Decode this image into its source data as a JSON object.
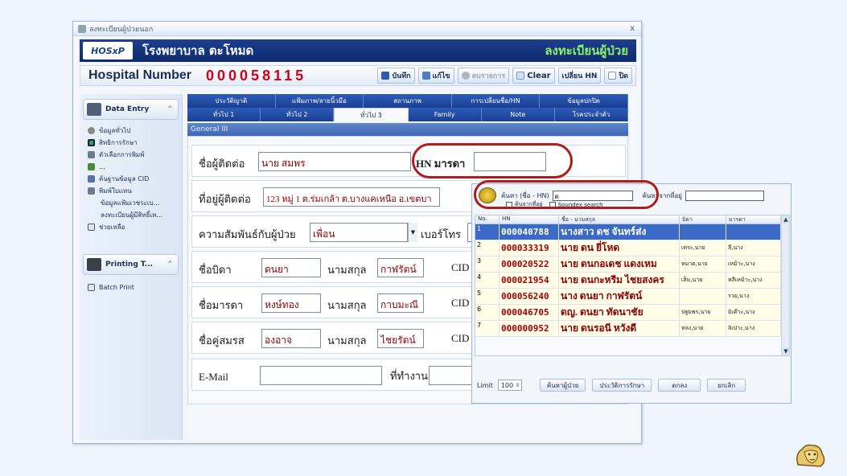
{
  "window": {
    "title": "ลงทะเบียนผู้ป่วยนอก",
    "close": "x"
  },
  "banner": {
    "logo_text": "HOSxP",
    "hospital": "โรงพยาบาล ตะโหมด",
    "page": "ลงทะเบียนผู้ป่วย"
  },
  "hnbar": {
    "label": "Hospital Number",
    "value": "000058115"
  },
  "toolbar": {
    "save": "บันทึก",
    "edit": "แก้ไข",
    "delete": "ลบรายการ",
    "clear": "Clear",
    "change_hn": "เปลี่ยน HN",
    "close": "ปิด"
  },
  "sidebar": {
    "data_entry_title": "Data Entry",
    "items": [
      {
        "label": "ข้อมูลทั่วไป",
        "icon": "user-icon"
      },
      {
        "label": "สิทธิการรักษา",
        "icon": "rights-icon"
      },
      {
        "label": "ตัวเลือกการพิมพ์",
        "icon": "print-option-icon"
      },
      {
        "label": "...",
        "icon": "more-icon"
      },
      {
        "label": "ค้นฐานข้อมูล CID",
        "icon": "cid-search-icon"
      },
      {
        "label": "พิมพ์ใบแทน",
        "icon": "print-icon"
      },
      {
        "label": "ข้อมูลแฟ้มเวชระเบ...",
        "icon": ""
      },
      {
        "label": "ลงทะเบียนผู้มีสิทธิ์เห...",
        "icon": ""
      },
      {
        "label": "ช่วยเหลือ",
        "icon": "help-icon"
      }
    ],
    "printing_title": "Printing T...",
    "batch_print": "Batch Print"
  },
  "tabs": {
    "row1": [
      "ประวัติญาติ",
      "แฟ้มภาพ/ลายนิ้วมือ",
      "สถานภาพ",
      "การเปลี่ยนชื่อ/HN",
      "ข้อมูลปกปิด"
    ],
    "row2": [
      "ทั่วไป 1",
      "ทั่วไป 2",
      "ทั่วไป 3",
      "Family",
      "Note",
      "โรคประจำตัว"
    ]
  },
  "group_title": "General III",
  "form": {
    "contact_label": "ชื่อผู้ติดต่อ",
    "contact_value": "นาย สมพร",
    "hn_mother_label": "HN มารดา",
    "hn_mother_value": "",
    "address_label": "ที่อยู่ผู้ติดต่อ",
    "address_value": "123 หมู่ 1 ต.ร่มเกล้า ต.บางแคเหนือ อ.เขตบา",
    "relation_label": "ความสัมพันธ์กับผู้ป่วย",
    "relation_value": "เพื่อน",
    "phone_label": "เบอร์โทร",
    "father_label": "ชื่อบิดา",
    "father_value": "ดนยา",
    "surname_label": "นามสกุล",
    "father_surname": "กาฬรัตน์",
    "cid_label": "CID",
    "mother_label": "ชื่อมารดา",
    "mother_value": "หงษ์ทอง",
    "mother_surname": "กาบมะณี",
    "spouse_label": "ชื่อคู่สมรส",
    "spouse_value": "องอาจ",
    "spouse_surname": "ไชยรัตน์",
    "email_label": "E-Mail",
    "workplace_label": "ที่ทำงาน"
  },
  "popup": {
    "search_label": "ค้นหา (ชื่อ - HN)",
    "search_value": "ด",
    "addr_search_label": "ค้นหาจากที่อยู่",
    "chk1": "ค้นจากที่อยู่",
    "chk2": "Soundex search",
    "columns": [
      "No.",
      "HN",
      "ชื่อ - นามสกุล",
      "บิดา",
      "มารดา"
    ],
    "rows": [
      {
        "no": "1",
        "hn": "000040788",
        "name": "นางสาว ดช  จันทร์ส่ง",
        "father": "",
        "mother": ""
      },
      {
        "no": "2",
        "hn": "000033319",
        "name": "นาย ดน  ยี่โหด",
        "father": "เทระ,นาย",
        "mother": "ลี,นาง"
      },
      {
        "no": "3",
        "hn": "000020522",
        "name": "นาย ดนกอเดช  แดงเหม",
        "father": "หมาด,นาย",
        "mother": "เหม้าะ,นาง"
      },
      {
        "no": "4",
        "hn": "000021954",
        "name": "นาย ดนกะหรีม  ไชยสงคร",
        "father": "เส็ม,นาย",
        "mother": "หลีเหม้าะ,นาง"
      },
      {
        "no": "5",
        "hn": "000056240",
        "name": "นาง ดนยา  กาฬรัตน์",
        "father": "",
        "mother": "รวย,นาง"
      },
      {
        "no": "6",
        "hn": "000046705",
        "name": "ดญ. ดนยา  ทัดนาชัย",
        "father": "ปฐมพร,นาย",
        "mother": "มิเด๊าะ,นาง"
      },
      {
        "no": "7",
        "hn": "000000952",
        "name": "นาย ดนรอนี  หวังดี",
        "father": "หลง,นาย",
        "mother": "ลิเปาะ,นาง"
      }
    ],
    "limit_label": "Limit",
    "limit_value": "100",
    "btn_find": "ค้นหาผู้ป่วย",
    "btn_history": "ประวัติการรักษา",
    "btn_ok": "ตกลง",
    "btn_cancel": "ยกเลิก"
  },
  "colors": {
    "banner": "#1d3f8f",
    "hn": "#d0021b",
    "callout": "#b01c1c",
    "selected": "#3b6ac6"
  }
}
